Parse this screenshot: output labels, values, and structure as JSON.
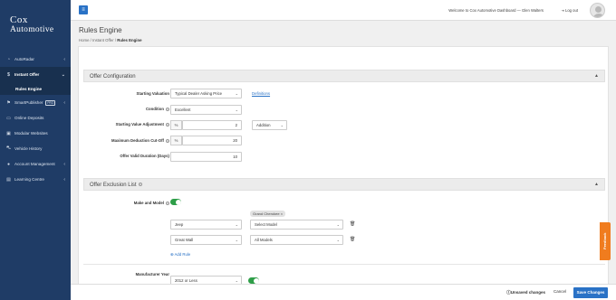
{
  "brand": {
    "line1": "Cox",
    "line2": "Automotive"
  },
  "sidebar": {
    "items": [
      {
        "label": "AutoRadar",
        "icon": "gauge-icon",
        "chevron": true
      },
      {
        "label": "Instant Offer",
        "icon": "dollar-icon",
        "chevron": true,
        "active": true,
        "sub": "Rules Engine"
      },
      {
        "label": "SmartPublisher",
        "icon": "flag-icon",
        "chevron": true,
        "badge": "PRO"
      },
      {
        "label": "Online Deposits",
        "icon": "card-icon"
      },
      {
        "label": "Modular Websites",
        "icon": "monitor-icon"
      },
      {
        "label": "Vehicle History",
        "icon": "car-icon"
      },
      {
        "label": "Account Management",
        "icon": "user-icon",
        "chevron": true
      },
      {
        "label": "Learning Centre",
        "icon": "book-icon",
        "chevron": true
      }
    ]
  },
  "topbar": {
    "welcome": "Welcome to Cox Automotive Dashboard — Glen Walters",
    "logout": "Log out"
  },
  "page": {
    "title": "Rules Engine",
    "breadcrumb": {
      "home": "Home",
      "parent": "Instant Offer",
      "current": "Rules Engine"
    }
  },
  "offer_config": {
    "title": "Offer Configuration",
    "starting_valuation": {
      "label": "Starting Valuation",
      "value": "Typical Dealer Asking Price",
      "link": "Definitions"
    },
    "condition": {
      "label": "Condition",
      "value": "Excellent"
    },
    "starting_value_adjustment": {
      "label": "Starting Value Adjustment",
      "unit": "%",
      "value": "2",
      "mode": "Addition"
    },
    "max_deduction": {
      "label": "Maximum Deduction Cut-Off",
      "unit": "%",
      "value": "20"
    },
    "valid_duration": {
      "label": "Offer Valid Duration (Days)",
      "value": "10"
    }
  },
  "exclusion_list": {
    "title": "Offer Exclusion List",
    "make_and_model": {
      "label": "Make and Model",
      "enabled": true
    },
    "chip": "Grand Cherokee",
    "rows": [
      {
        "make": "Jeep",
        "model": "Select Model"
      },
      {
        "make": "Great Wall",
        "model": "All Models"
      }
    ],
    "add_rule": "Add Rule",
    "manufacturer_year": {
      "label": "Manufacturer Year",
      "value": "2012 or Less",
      "enabled": true
    }
  },
  "bottombar": {
    "unsaved": "Unsaved changes",
    "cancel": "Cancel",
    "save": "Save Changes"
  },
  "feedback": "Feedback",
  "colors": {
    "sidebar": "#1f3c66",
    "accent": "#2a72c6",
    "toggle": "#2e9e48",
    "feedback": "#f07c1e"
  }
}
